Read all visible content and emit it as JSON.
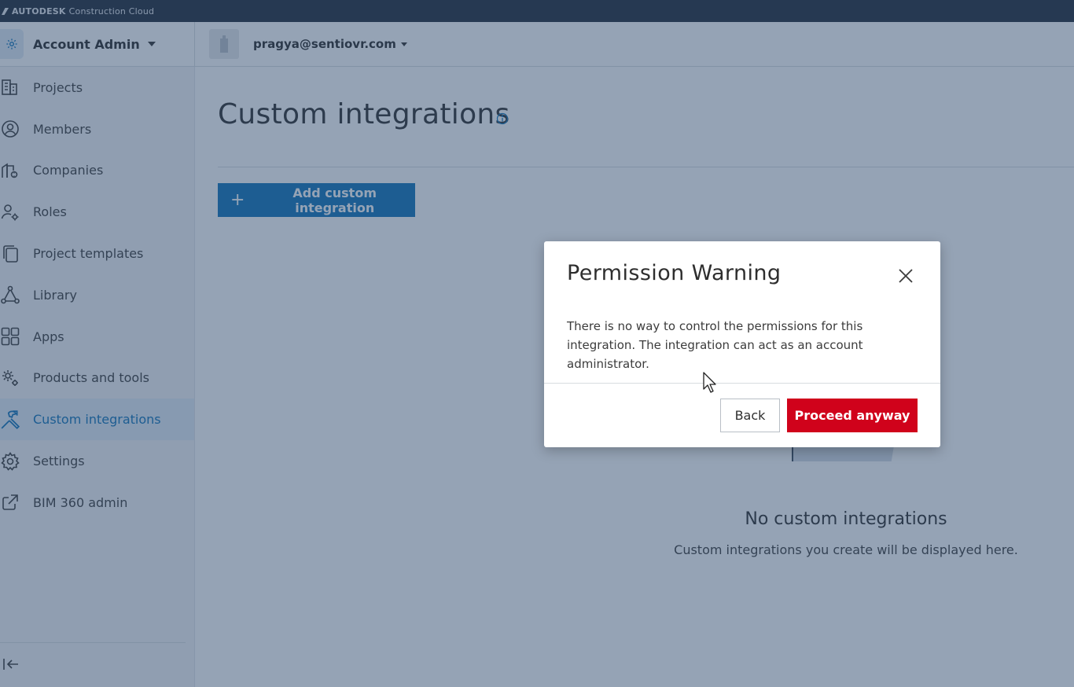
{
  "brand": {
    "name_bold": "AUTODESK",
    "name_rest": "Construction Cloud"
  },
  "header": {
    "account_label": "Account Admin",
    "user_email": "pragya@sentiovr.com"
  },
  "sidebar": {
    "items": [
      {
        "label": "Projects",
        "icon": "building-icon"
      },
      {
        "label": "Members",
        "icon": "person-icon"
      },
      {
        "label": "Companies",
        "icon": "companies-icon"
      },
      {
        "label": "Roles",
        "icon": "role-icon"
      },
      {
        "label": "Project templates",
        "icon": "templates-icon"
      },
      {
        "label": "Library",
        "icon": "library-icon"
      },
      {
        "label": "Apps",
        "icon": "apps-grid-icon"
      },
      {
        "label": "Products and tools",
        "icon": "products-gear-icon"
      },
      {
        "label": "Custom integrations",
        "icon": "tools-icon",
        "active": true
      },
      {
        "label": "Settings",
        "icon": "gear-icon"
      },
      {
        "label": "BIM 360 admin",
        "icon": "external-link-icon"
      }
    ]
  },
  "main": {
    "page_title": "Custom integrations",
    "add_button_label": "Add custom integration",
    "empty_title": "No custom integrations",
    "empty_subtitle": "Custom integrations you create will be displayed here."
  },
  "modal": {
    "title": "Permission Warning",
    "body": "There is no way to control the permissions for this integration. The integration can act as an account administrator.",
    "back_label": "Back",
    "proceed_label": "Proceed anyway"
  },
  "colors": {
    "accent": "#0e73b8",
    "danger": "#d0021b",
    "topbar": "#212b38"
  }
}
